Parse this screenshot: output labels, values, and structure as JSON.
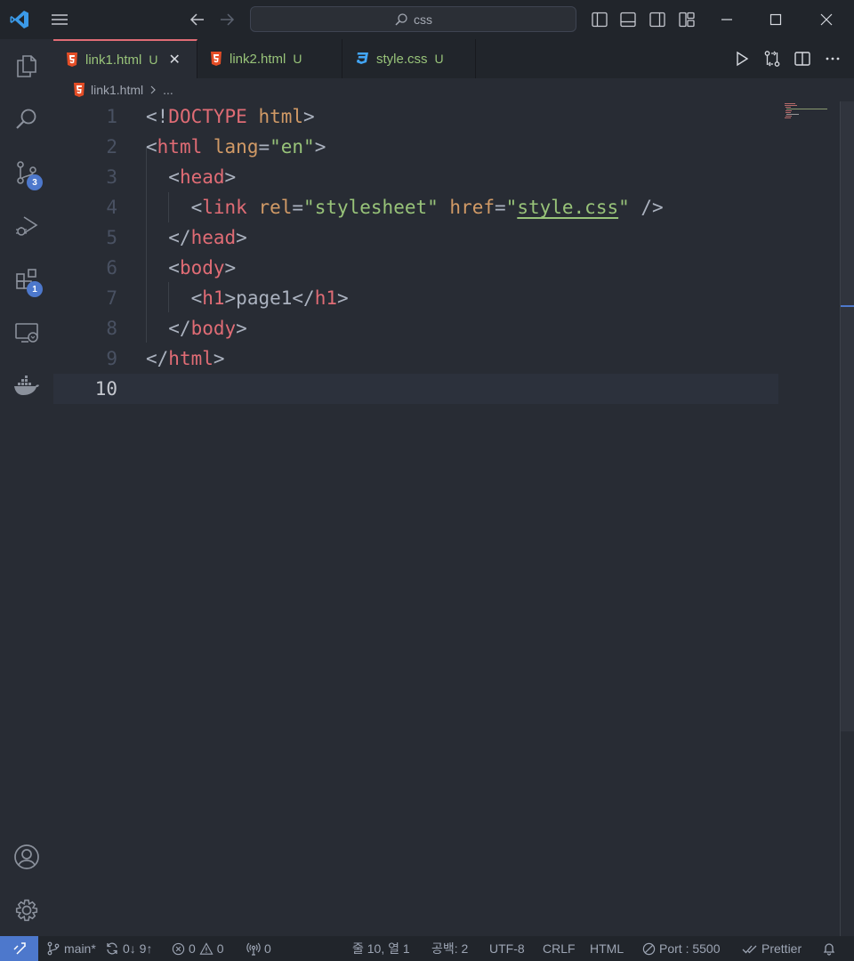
{
  "titlebar": {
    "search_text": "css"
  },
  "activitybar": {
    "source_control_badge": "3",
    "extensions_badge": "1"
  },
  "tabs": [
    {
      "label": "link1.html",
      "status": "U",
      "type": "html",
      "active": true
    },
    {
      "label": "link2.html",
      "status": "U",
      "type": "html",
      "active": false
    },
    {
      "label": "style.css",
      "status": "U",
      "type": "css",
      "active": false
    }
  ],
  "breadcrumb": {
    "file": "link1.html",
    "more": "..."
  },
  "editor": {
    "current_line": 10,
    "line_numbers": [
      "1",
      "2",
      "3",
      "4",
      "5",
      "6",
      "7",
      "8",
      "9",
      "10"
    ],
    "lines": [
      [
        {
          "t": "<!",
          "c": "pun"
        },
        {
          "t": "DOCTYPE",
          "c": "decl"
        },
        {
          "t": " ",
          "c": "pun"
        },
        {
          "t": "html",
          "c": "kw"
        },
        {
          "t": ">",
          "c": "pun"
        }
      ],
      [
        {
          "t": "<",
          "c": "pun"
        },
        {
          "t": "html",
          "c": "tag"
        },
        {
          "t": " ",
          "c": "pun"
        },
        {
          "t": "lang",
          "c": "attr"
        },
        {
          "t": "=",
          "c": "pun"
        },
        {
          "t": "\"en\"",
          "c": "str"
        },
        {
          "t": ">",
          "c": "pun"
        }
      ],
      [
        {
          "t": "  <",
          "c": "pun"
        },
        {
          "t": "head",
          "c": "tag"
        },
        {
          "t": ">",
          "c": "pun"
        }
      ],
      [
        {
          "t": "    <",
          "c": "pun"
        },
        {
          "t": "link",
          "c": "tag"
        },
        {
          "t": " ",
          "c": "pun"
        },
        {
          "t": "rel",
          "c": "attr"
        },
        {
          "t": "=",
          "c": "pun"
        },
        {
          "t": "\"stylesheet\"",
          "c": "str"
        },
        {
          "t": " ",
          "c": "pun"
        },
        {
          "t": "href",
          "c": "attr"
        },
        {
          "t": "=",
          "c": "pun"
        },
        {
          "t": "\"",
          "c": "str"
        },
        {
          "t": "style.css",
          "c": "link"
        },
        {
          "t": "\"",
          "c": "str"
        },
        {
          "t": " />",
          "c": "pun"
        }
      ],
      [
        {
          "t": "  </",
          "c": "pun"
        },
        {
          "t": "head",
          "c": "tag"
        },
        {
          "t": ">",
          "c": "pun"
        }
      ],
      [
        {
          "t": "  <",
          "c": "pun"
        },
        {
          "t": "body",
          "c": "tag"
        },
        {
          "t": ">",
          "c": "pun"
        }
      ],
      [
        {
          "t": "    <",
          "c": "pun"
        },
        {
          "t": "h1",
          "c": "tag"
        },
        {
          "t": ">",
          "c": "pun"
        },
        {
          "t": "page1",
          "c": "text"
        },
        {
          "t": "</",
          "c": "pun"
        },
        {
          "t": "h1",
          "c": "tag"
        },
        {
          "t": ">",
          "c": "pun"
        }
      ],
      [
        {
          "t": "  </",
          "c": "pun"
        },
        {
          "t": "body",
          "c": "tag"
        },
        {
          "t": ">",
          "c": "pun"
        }
      ],
      [
        {
          "t": "</",
          "c": "pun"
        },
        {
          "t": "html",
          "c": "tag"
        },
        {
          "t": ">",
          "c": "pun"
        }
      ],
      []
    ]
  },
  "statusbar": {
    "branch": "main*",
    "sync": "0↓ 9↑",
    "errors": "0",
    "warnings": "0",
    "ports": "0",
    "cursor": "줄 10, 열 1",
    "spaces": "공백: 2",
    "encoding": "UTF-8",
    "eol": "CRLF",
    "language": "HTML",
    "live_server": "Port : 5500",
    "prettier": "Prettier"
  },
  "colors": {
    "accent": "#4d78cc",
    "html_icon": "#e44d26",
    "css_icon": "#42a5f5",
    "tab_text": "#98c379"
  }
}
